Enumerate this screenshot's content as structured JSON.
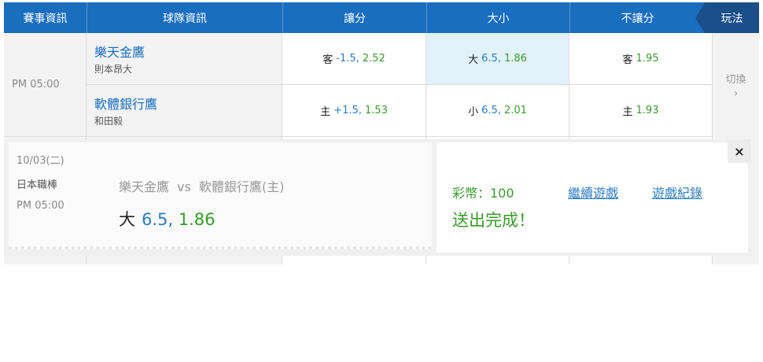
{
  "header": {
    "event_info": "賽事資訊",
    "team_info": "球隊資訊",
    "handicap": "讓分",
    "over_under": "大小",
    "moneyline": "不讓分",
    "play_tab": "玩法"
  },
  "match": {
    "time": "PM 05:00",
    "away": {
      "name": "樂天金鷹",
      "pitcher": "則本昂大"
    },
    "home": {
      "name": "軟體銀行鷹",
      "pitcher": "和田毅"
    },
    "odds": {
      "away_handicap": {
        "label": "客",
        "line": "-1.5",
        "price": "2.52"
      },
      "home_handicap": {
        "label": "主",
        "line": "+1.5",
        "price": "1.53"
      },
      "over": {
        "label": "大",
        "line": "6.5",
        "price": "1.86"
      },
      "under": {
        "label": "小",
        "line": "6.5",
        "price": "2.01"
      },
      "away_ml": {
        "label": "客",
        "price": "1.95"
      },
      "home_ml": {
        "label": "主",
        "price": "1.93"
      }
    },
    "switch_label": "切換",
    "switch_chevron": "›"
  },
  "ticket": {
    "date": "10/03(二)",
    "league": "日本職棒",
    "time": "PM 05:00",
    "away": "樂天金鷹",
    "vs": "vs",
    "home": "軟體銀行鷹(主)",
    "pick_label": "大",
    "pick_line": "6.5",
    "pick_price": "1.86",
    "stake": "彩幣：100",
    "submitted": "送出完成！",
    "continue_link": "繼續遊戲",
    "history_link": "遊戲紀錄",
    "close": "×"
  },
  "colors": {
    "header_blue": "#1a6ec0",
    "tab_dark_blue": "#1a4f8a",
    "highlight": "#e2f2fb",
    "odds_line_blue": "#2b7cc4",
    "odds_price_green": "#3a9a2b"
  }
}
